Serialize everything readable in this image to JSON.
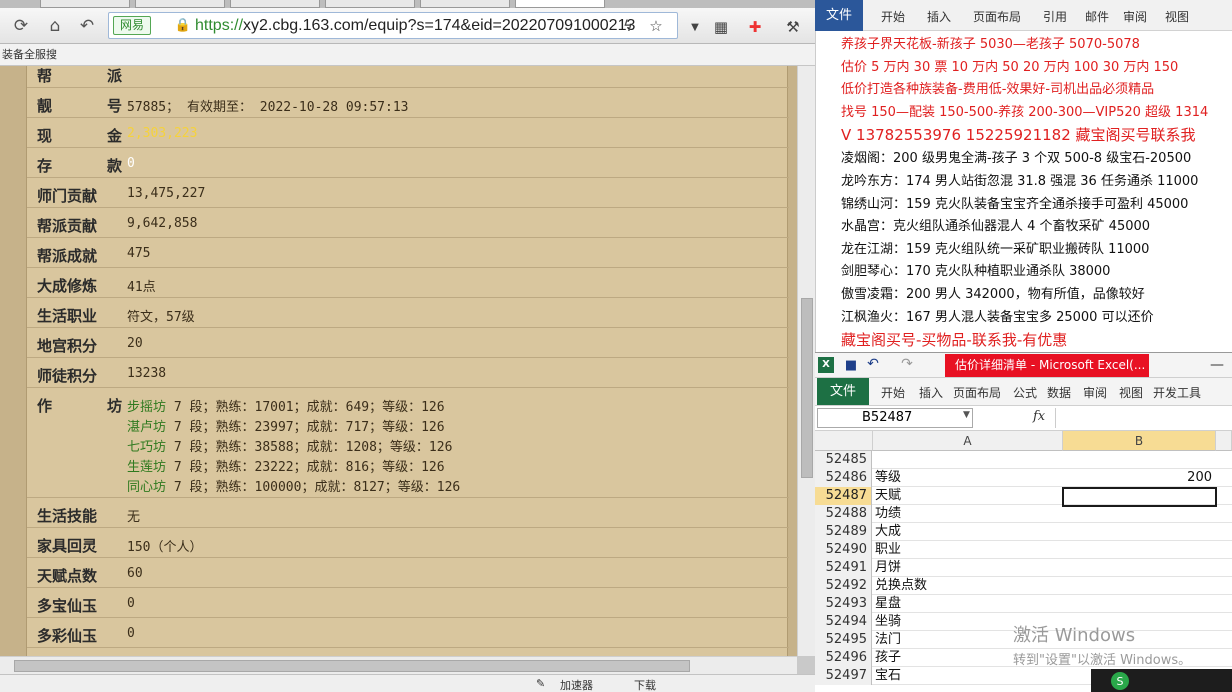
{
  "browser": {
    "url_protocol": "https://",
    "url_rest": "xy2.cbg.163.com/equip?s=174&eid=202207091000213",
    "site_badge": "网易",
    "bookmark_text": "装备全服搜",
    "status_items": [
      "加速器",
      "下载"
    ]
  },
  "equip": {
    "rows": [
      {
        "label": "帮　派",
        "value": ""
      },
      {
        "label": "靓　号",
        "value": "57885； 有效期至： 2022-10-28 09:57:13"
      },
      {
        "label": "现　金",
        "value": "2,303,223"
      },
      {
        "label": "存　款",
        "value": "0"
      },
      {
        "label": "师门贡献",
        "value": "13,475,227"
      },
      {
        "label": "帮派贡献",
        "value": "9,642,858"
      },
      {
        "label": "帮派成就",
        "value": "475"
      },
      {
        "label": "大成修炼",
        "value": "41点"
      },
      {
        "label": "生活职业",
        "value": "符文，57级"
      },
      {
        "label": "地宫积分",
        "value": "20"
      },
      {
        "label": "师徒积分",
        "value": "13238"
      }
    ],
    "workshop_label": "作　坊",
    "workshops": [
      {
        "name": "步摇坊",
        "info": " 7 段；熟练：17001；成就：649；等级：126"
      },
      {
        "name": "湛卢坊",
        "info": " 7 段；熟练：23997；成就：717；等级：126"
      },
      {
        "name": "七巧坊",
        "info": " 7 段；熟练：38588；成就：1208；等级：126"
      },
      {
        "name": "生莲坊",
        "info": " 7 段；熟练：23222；成就：816；等级：126"
      },
      {
        "name": "同心坊",
        "info": " 7 段；熟练：100000；成就：8127；等级：126"
      }
    ],
    "rows2": [
      {
        "label": "生活技能",
        "value": "无"
      },
      {
        "label": "家具回灵",
        "value": "150（个人）"
      },
      {
        "label": "天赋点数",
        "value": "60"
      },
      {
        "label": "多宝仙玉",
        "value": "0"
      },
      {
        "label": "多彩仙玉",
        "value": "0"
      }
    ]
  },
  "word": {
    "file_tab": "文件",
    "tabs": [
      "开始",
      "插入",
      "页面布局",
      "引用",
      "邮件",
      "审阅",
      "视图"
    ],
    "lines": [
      {
        "text": "养孩子界天花板-新孩子 5030—老孩子 5070-5078",
        "color": "red"
      },
      {
        "text": "估价 5 万内 30 票  10 万内 50  20 万内 100  30 万内 150",
        "color": "red"
      },
      {
        "text": "低价打造各种族装备-费用低-效果好-司机出品必须精品",
        "color": "red"
      },
      {
        "text": "找号 150—配装 150-500-养孩 200-300—VIP520 超级 1314",
        "color": "red"
      },
      {
        "text": "V 13782553976   15225921182  藏宝阁买号联系我",
        "color": "red",
        "big": true
      },
      {
        "text": "凌烟阁：200 级男鬼全满-孩子 3 个双 500-8 级宝石-20500",
        "color": "black"
      },
      {
        "text": "龙吟东方：174 男人站街忽混 31.8 强混 36 任务通杀 11000",
        "color": "black"
      },
      {
        "text": "锦绣山河：159 克火队装备宝宝齐全通杀接手可盈利 45000",
        "color": "black"
      },
      {
        "text": "水晶宫：克火组队通杀仙器混人 4 个畜牧采矿 45000",
        "color": "black"
      },
      {
        "text": "龙在江湖：159 克火组队统一采矿职业搬砖队 11000",
        "color": "black"
      },
      {
        "text": "剑胆琴心：170 克火队种植职业通杀队 38000",
        "color": "black"
      },
      {
        "text": "傲雪凌霜：200 男人 342000，物有所值，品像较好",
        "color": "black"
      },
      {
        "text": "江枫渔火：167 男人混人装备宝宝多 25000 可以还价",
        "color": "black"
      },
      {
        "text": "藏宝阁买号-买物品-联系我-有优惠",
        "color": "red",
        "big": true
      }
    ]
  },
  "excel": {
    "title": "估价详细清单 - Microsoft Excel(...",
    "file_tab": "文件",
    "tabs": [
      "开始",
      "插入",
      "页面布局",
      "公式",
      "数据",
      "审阅",
      "视图",
      "开发工具"
    ],
    "name_box": "B52487",
    "fx": "fx",
    "columns": [
      "A",
      "B"
    ],
    "rows": [
      {
        "num": "52485",
        "a": "",
        "b": ""
      },
      {
        "num": "52486",
        "a": "等级",
        "b": "200"
      },
      {
        "num": "52487",
        "a": "天赋",
        "b": ""
      },
      {
        "num": "52488",
        "a": "功绩",
        "b": ""
      },
      {
        "num": "52489",
        "a": "大成",
        "b": ""
      },
      {
        "num": "52490",
        "a": "职业",
        "b": ""
      },
      {
        "num": "52491",
        "a": "月饼",
        "b": ""
      },
      {
        "num": "52492",
        "a": "兑换点数",
        "b": ""
      },
      {
        "num": "52493",
        "a": "星盘",
        "b": ""
      },
      {
        "num": "52494",
        "a": "坐骑",
        "b": ""
      },
      {
        "num": "52495",
        "a": "法门",
        "b": ""
      },
      {
        "num": "52496",
        "a": "孩子",
        "b": ""
      },
      {
        "num": "52497",
        "a": "宝石",
        "b": ""
      }
    ],
    "activation_title": "激活 Windows",
    "activation_sub": "转到\"设置\"以激活 Windows。"
  }
}
